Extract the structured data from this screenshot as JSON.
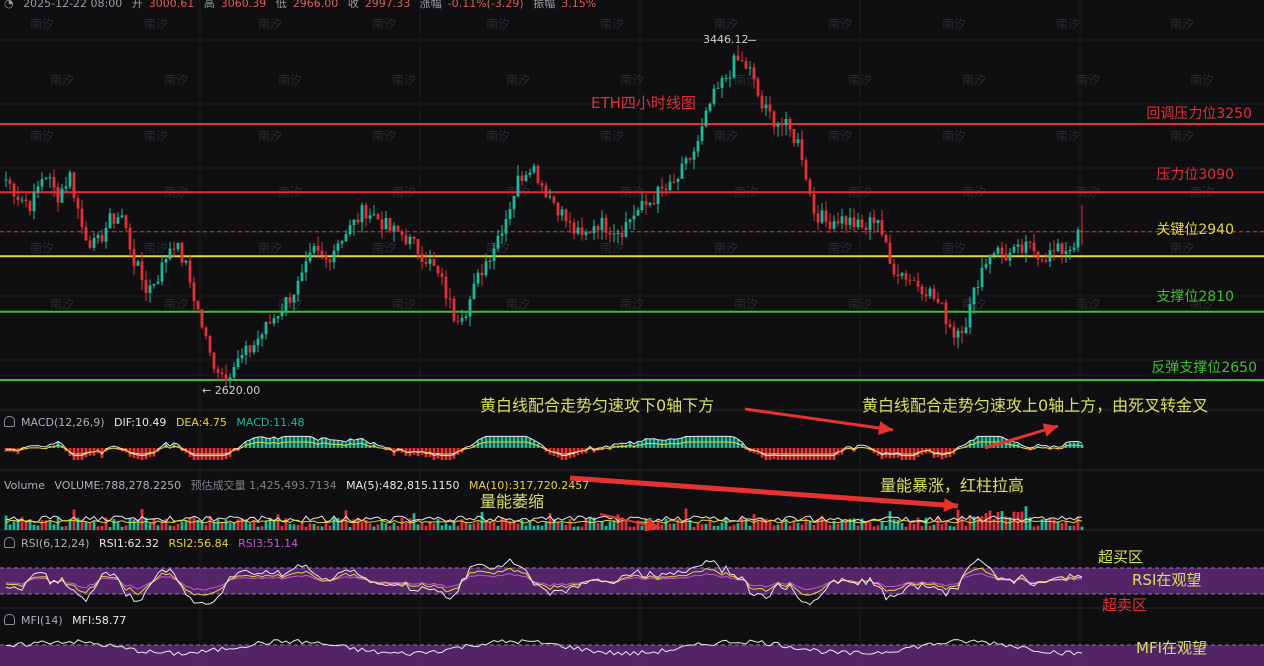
{
  "header": {
    "datetime": "2025-12-22 08:00",
    "open_label": "开",
    "open": "3000.61",
    "high_label": "高",
    "high": "3060.39",
    "low_label": "低",
    "low": "2966.00",
    "close_label": "收",
    "close": "2997.33",
    "change_label": "涨幅",
    "change": "-0.11%(-3.29)",
    "amplitude_label": "振幅",
    "amplitude": "3.15%"
  },
  "watermark": "南汐",
  "main": {
    "title": "ETH四小时线图",
    "high_marker": "3446.12",
    "low_marker": "← 2620.00",
    "levels": [
      {
        "label": "回调压力位3250",
        "value": 3250,
        "color": "#e0303a"
      },
      {
        "label": "压力位3090",
        "value": 3090,
        "color": "#e0303a"
      },
      {
        "label": "关键位2940",
        "value": 2940,
        "color": "#e6d33a"
      },
      {
        "label": "支撑位2810",
        "value": 2810,
        "color": "#3fbf2e"
      },
      {
        "label": "反弹支撑位2650",
        "value": 2650,
        "color": "#3fbf2e"
      }
    ]
  },
  "macd": {
    "title": "MACD(12,26,9)",
    "dif": "DIF:10.49",
    "dea": "DEA:4.75",
    "macd": "MACD:11.48",
    "annotation_left": "黄白线配合走势匀速攻下0轴下方",
    "annotation_right": "黄白线配合走势匀速攻上0轴上方，由死叉转金叉"
  },
  "volume": {
    "title": "Volume",
    "volume": "VOLUME:788,278.2250",
    "estimate": "预估成交量 1,425,493.7134",
    "ma5": "MA(5):482,815.1150",
    "ma10": "MA(10):317,720.2457",
    "annotation_left": "量能萎缩",
    "annotation_right": "量能暴涨，红柱拉高"
  },
  "rsi": {
    "title": "RSI(6,12,24)",
    "rsi1": "RSI1:62.32",
    "rsi2": "RSI2:56.84",
    "rsi3": "RSI3:51.14",
    "overbought": "超买区",
    "status": "RSI在观望",
    "oversold": "超卖区"
  },
  "mfi": {
    "title": "MFI(14)",
    "mfi": "MFI:58.77",
    "status": "MFI在观望"
  },
  "chart_data": {
    "type": "candlestick",
    "title": "ETH四小时线图",
    "y_range_visible": [
      2600,
      3460
    ],
    "high_marker": 3446.12,
    "low_marker": 2620.0,
    "horizontal_levels": [
      3250,
      3090,
      2940,
      2810,
      2650
    ],
    "last_candle": {
      "open": 3000.61,
      "high": 3060.39,
      "low": 2966.0,
      "close": 2997.33
    },
    "colors": {
      "up": "#1fb89a",
      "down": "#e0303a",
      "dif": "#e8e8e8",
      "dea": "#e6d33a",
      "rsi_band": "#6b2c86"
    },
    "close_path": [
      3120,
      3080,
      3060,
      3140,
      3080,
      3130,
      3000,
      2960,
      3020,
      3040,
      2930,
      2860,
      2900,
      2980,
      2920,
      2810,
      2700,
      2660,
      2690,
      2720,
      2760,
      2800,
      2840,
      2880,
      2950,
      2930,
      2980,
      3010,
      3050,
      3030,
      3000,
      2990,
      2960,
      2930,
      2880,
      2800,
      2820,
      2900,
      2960,
      3030,
      3120,
      3160,
      3100,
      3060,
      3010,
      2980,
      3020,
      3010,
      3000,
      3040,
      3060,
      3090,
      3100,
      3150,
      3200,
      3300,
      3350,
      3400,
      3380,
      3290,
      3260,
      3240,
      3200,
      3050,
      3020,
      3030,
      3020,
      3000,
      3040,
      2920,
      2900,
      2880,
      2860,
      2820,
      2760,
      2790,
      2900,
      2960,
      2940,
      2950,
      2960,
      2940,
      2950,
      2960,
      2997.33
    ]
  }
}
